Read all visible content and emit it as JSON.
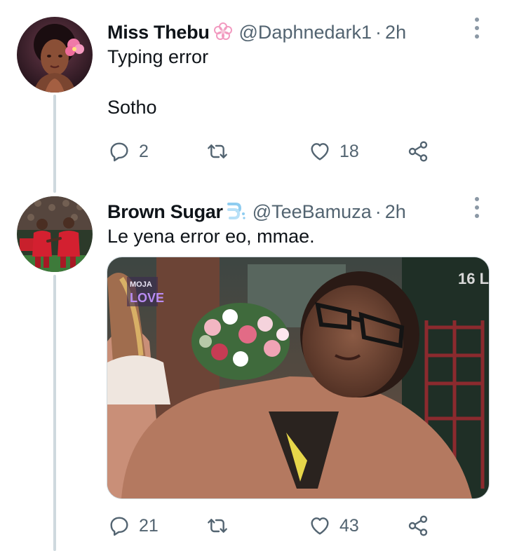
{
  "tweets": [
    {
      "name": "Miss Thebu",
      "badge_icon": "flower-emoji-icon",
      "handle": "@Daphnedark1",
      "separator": "·",
      "time": "2h",
      "text": "Typing error\n\nSotho",
      "replies": "2",
      "retweets": "",
      "likes": "18"
    },
    {
      "name": "Brown Sugar",
      "badge_icon": "dash-emoji-icon",
      "handle": "@TeeBamuza",
      "separator": "·",
      "time": "2h",
      "text": "Le yena error eo, mmae.",
      "replies": "21",
      "retweets": "",
      "likes": "43",
      "media": {
        "logo_top": "MOJA",
        "logo_bottom": "LOVE",
        "corner_text": "16 L"
      }
    }
  ],
  "colors": {
    "text": "#0f1419",
    "secondary": "#536471",
    "thread_line": "#cfd9de"
  }
}
